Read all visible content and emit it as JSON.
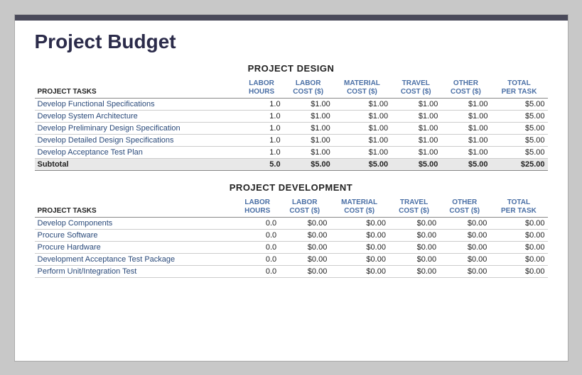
{
  "title": "Project Budget",
  "sections": [
    {
      "name": "PROJECT DESIGN",
      "columns": [
        "PROJECT TASKS",
        "LABOR\nHOURS",
        "LABOR\nCOST ($)",
        "MATERIAL\nCOST ($)",
        "TRAVEL\nCOST ($)",
        "OTHER\nCOST ($)",
        "TOTAL\nPER TASK"
      ],
      "rows": [
        {
          "task": "Develop Functional Specifications",
          "hours": "1.0",
          "labor": "$1.00",
          "material": "$1.00",
          "travel": "$1.00",
          "other": "$1.00",
          "total": "$5.00"
        },
        {
          "task": "Develop System Architecture",
          "hours": "1.0",
          "labor": "$1.00",
          "material": "$1.00",
          "travel": "$1.00",
          "other": "$1.00",
          "total": "$5.00"
        },
        {
          "task": "Develop Preliminary Design Specification",
          "hours": "1.0",
          "labor": "$1.00",
          "material": "$1.00",
          "travel": "$1.00",
          "other": "$1.00",
          "total": "$5.00"
        },
        {
          "task": "Develop Detailed Design Specifications",
          "hours": "1.0",
          "labor": "$1.00",
          "material": "$1.00",
          "travel": "$1.00",
          "other": "$1.00",
          "total": "$5.00"
        },
        {
          "task": "Develop Acceptance Test Plan",
          "hours": "1.0",
          "labor": "$1.00",
          "material": "$1.00",
          "travel": "$1.00",
          "other": "$1.00",
          "total": "$5.00"
        }
      ],
      "subtotal": {
        "label": "Subtotal",
        "hours": "5.0",
        "labor": "$5.00",
        "material": "$5.00",
        "travel": "$5.00",
        "other": "$5.00",
        "total": "$25.00"
      }
    },
    {
      "name": "PROJECT DEVELOPMENT",
      "columns": [
        "PROJECT TASKS",
        "LABOR\nHOURS",
        "LABOR\nCOST ($)",
        "MATERIAL\nCOST ($)",
        "TRAVEL\nCOST ($)",
        "OTHER\nCOST ($)",
        "TOTAL\nPER TASK"
      ],
      "rows": [
        {
          "task": "Develop Components",
          "hours": "0.0",
          "labor": "$0.00",
          "material": "$0.00",
          "travel": "$0.00",
          "other": "$0.00",
          "total": "$0.00"
        },
        {
          "task": "Procure Software",
          "hours": "0.0",
          "labor": "$0.00",
          "material": "$0.00",
          "travel": "$0.00",
          "other": "$0.00",
          "total": "$0.00"
        },
        {
          "task": "Procure Hardware",
          "hours": "0.0",
          "labor": "$0.00",
          "material": "$0.00",
          "travel": "$0.00",
          "other": "$0.00",
          "total": "$0.00"
        },
        {
          "task": "Development Acceptance Test Package",
          "hours": "0.0",
          "labor": "$0.00",
          "material": "$0.00",
          "travel": "$0.00",
          "other": "$0.00",
          "total": "$0.00"
        },
        {
          "task": "Perform Unit/Integration Test",
          "hours": "0.0",
          "labor": "$0.00",
          "material": "$0.00",
          "travel": "$0.00",
          "other": "$0.00",
          "total": "$0.00"
        }
      ],
      "subtotal": null
    }
  ]
}
